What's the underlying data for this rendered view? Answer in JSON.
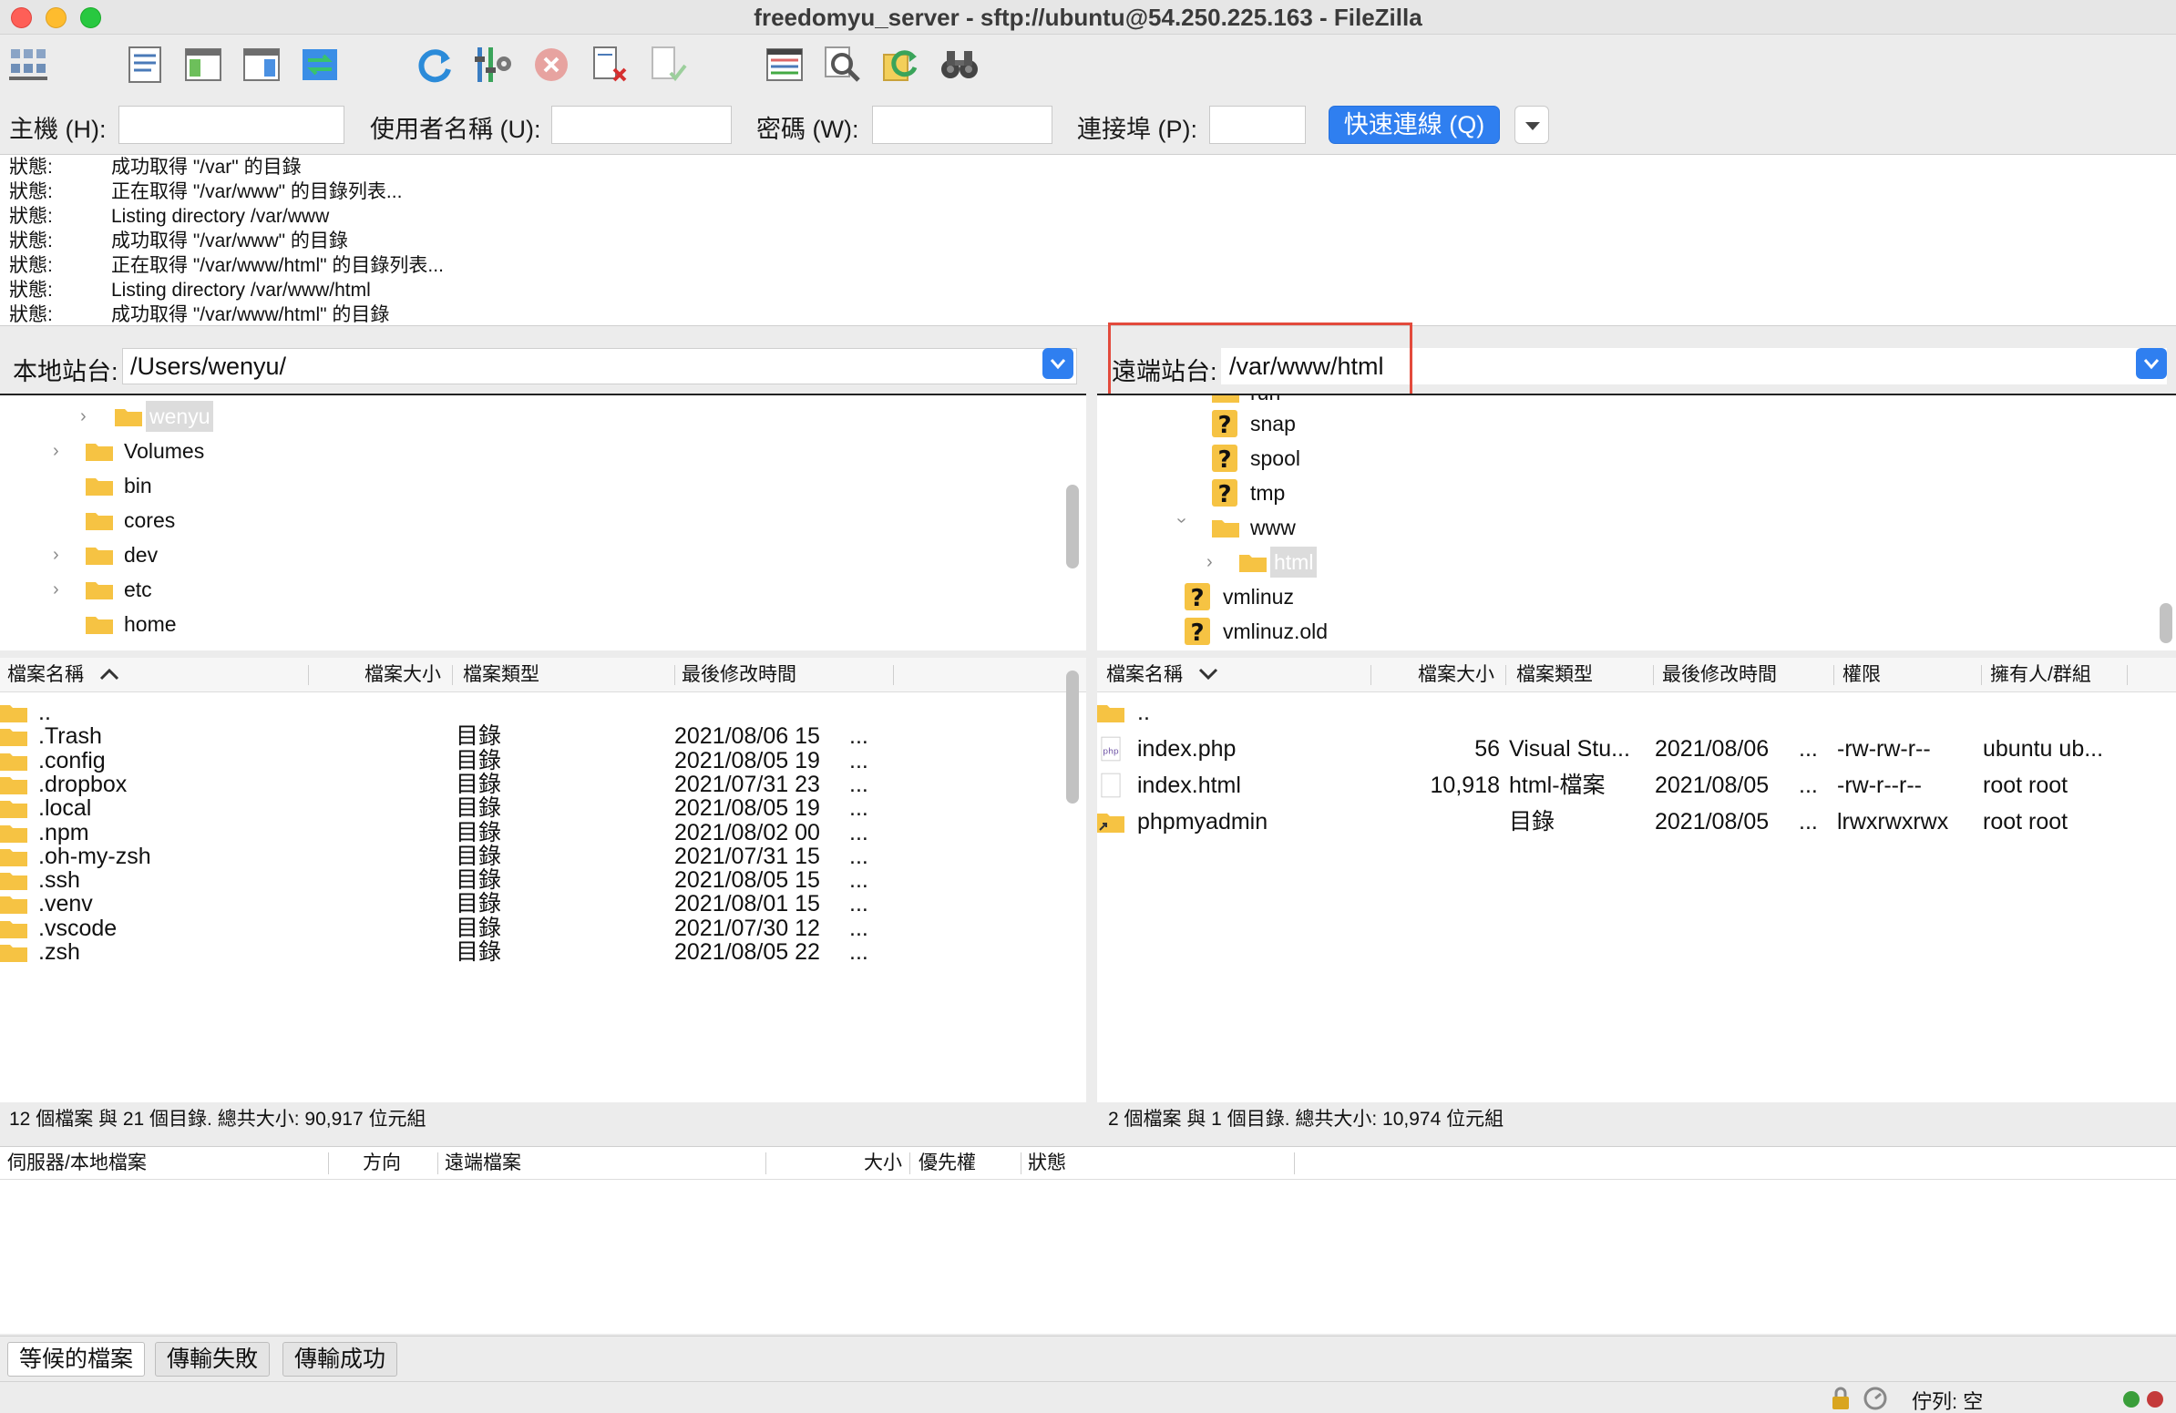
{
  "window": {
    "title": "freedomyu_server - sftp://ubuntu@54.250.225.163 - FileZilla"
  },
  "toolbar": {
    "icons": [
      "site-manager-icon",
      "message-log-icon",
      "local-tree-icon",
      "remote-tree-icon",
      "transfer-queue-icon",
      "refresh-icon",
      "filter-icon",
      "cancel-icon",
      "disconnect-icon",
      "reconnect-icon",
      "compare-icon",
      "search-icon",
      "sync-browse-icon",
      "find-files-icon"
    ]
  },
  "quickconnect": {
    "host_label": "主機 (H):",
    "user_label": "使用者名稱 (U):",
    "pass_label": "密碼 (W):",
    "port_label": "連接埠 (P):",
    "host_value": "",
    "user_value": "",
    "pass_value": "",
    "port_value": "",
    "button": "快速連線 (Q)"
  },
  "log": [
    {
      "key": "狀態:",
      "msg": "成功取得 \"/var\" 的目錄"
    },
    {
      "key": "狀態:",
      "msg": "正在取得 \"/var/www\" 的目錄列表..."
    },
    {
      "key": "狀態:",
      "msg": "Listing directory /var/www"
    },
    {
      "key": "狀態:",
      "msg": "成功取得 \"/var/www\" 的目錄"
    },
    {
      "key": "狀態:",
      "msg": "正在取得 \"/var/www/html\" 的目錄列表..."
    },
    {
      "key": "狀態:",
      "msg": "Listing directory /var/www/html"
    },
    {
      "key": "狀態:",
      "msg": "成功取得 \"/var/www/html\" 的目錄"
    }
  ],
  "local": {
    "label": "本地站台:",
    "path": "/Users/wenyu/",
    "tree": [
      {
        "name": "wenyu",
        "selected": true
      },
      {
        "name": "Volumes"
      },
      {
        "name": "bin"
      },
      {
        "name": "cores"
      },
      {
        "name": "dev"
      },
      {
        "name": "etc"
      },
      {
        "name": "home"
      }
    ],
    "columns": {
      "name": "檔案名稱",
      "size": "檔案大小",
      "type": "檔案類型",
      "modified": "最後修改時間"
    },
    "files": [
      {
        "name": "..",
        "type": "",
        "modified": ""
      },
      {
        "name": ".Trash",
        "type": "目錄",
        "modified": "2021/08/06 15",
        "more": "..."
      },
      {
        "name": ".config",
        "type": "目錄",
        "modified": "2021/08/05 19",
        "more": "..."
      },
      {
        "name": ".dropbox",
        "type": "目錄",
        "modified": "2021/07/31 23",
        "more": "..."
      },
      {
        "name": ".local",
        "type": "目錄",
        "modified": "2021/08/05 19",
        "more": "..."
      },
      {
        "name": ".npm",
        "type": "目錄",
        "modified": "2021/08/02 00",
        "more": "..."
      },
      {
        "name": ".oh-my-zsh",
        "type": "目錄",
        "modified": "2021/07/31 15",
        "more": "..."
      },
      {
        "name": ".ssh",
        "type": "目錄",
        "modified": "2021/08/05 15",
        "more": "..."
      },
      {
        "name": ".venv",
        "type": "目錄",
        "modified": "2021/08/01 15",
        "more": "..."
      },
      {
        "name": ".vscode",
        "type": "目錄",
        "modified": "2021/07/30 12",
        "more": "..."
      },
      {
        "name": ".zsh",
        "type": "目錄",
        "modified": "2021/08/05 22",
        "more": "..."
      }
    ],
    "status": "12 個檔案 與 21 個目錄. 總共大小: 90,917 位元組"
  },
  "remote": {
    "label": "遠端站台:",
    "path": "/var/www/html",
    "tree": [
      {
        "name": "run",
        "kind": "folder"
      },
      {
        "name": "snap",
        "kind": "unknown"
      },
      {
        "name": "spool",
        "kind": "unknown"
      },
      {
        "name": "tmp",
        "kind": "unknown"
      },
      {
        "name": "www",
        "kind": "folder"
      },
      {
        "name": "html",
        "kind": "folder",
        "selected": true
      },
      {
        "name": "vmlinuz",
        "kind": "unknown"
      },
      {
        "name": "vmlinuz.old",
        "kind": "unknown"
      }
    ],
    "columns": {
      "name": "檔案名稱",
      "size": "檔案大小",
      "type": "檔案類型",
      "modified": "最後修改時間",
      "perm": "權限",
      "owner": "擁有人/群組"
    },
    "files": [
      {
        "name": "..",
        "size": "",
        "type": "",
        "modified": "",
        "more": "",
        "perm": "",
        "owner": ""
      },
      {
        "name": "index.php",
        "size": "56",
        "type": "Visual Stu...",
        "modified": "2021/08/06",
        "more": "...",
        "perm": "-rw-rw-r--",
        "owner": "ubuntu ub..."
      },
      {
        "name": "index.html",
        "size": "10,918",
        "type": "html-檔案",
        "modified": "2021/08/05",
        "more": "...",
        "perm": "-rw-r--r--",
        "owner": "root root"
      },
      {
        "name": "phpmyadmin",
        "size": "",
        "type": "目錄",
        "modified": "2021/08/05",
        "more": "...",
        "perm": "lrwxrwxrwx",
        "owner": "root root"
      }
    ],
    "status": "2 個檔案 與 1 個目錄. 總共大小: 10,974 位元組"
  },
  "queue": {
    "columns": {
      "server": "伺服器/本地檔案",
      "direction": "方向",
      "remote": "遠端檔案",
      "size": "大小",
      "priority": "優先權",
      "status": "狀態"
    }
  },
  "tabs": [
    "等候的檔案",
    "傳輸失敗",
    "傳輸成功"
  ],
  "statusbar": {
    "queue": "佇列: 空"
  },
  "colors": {
    "accent": "#2f7ff0",
    "highlight": "#e34a3c",
    "folder": "#f6c343"
  }
}
